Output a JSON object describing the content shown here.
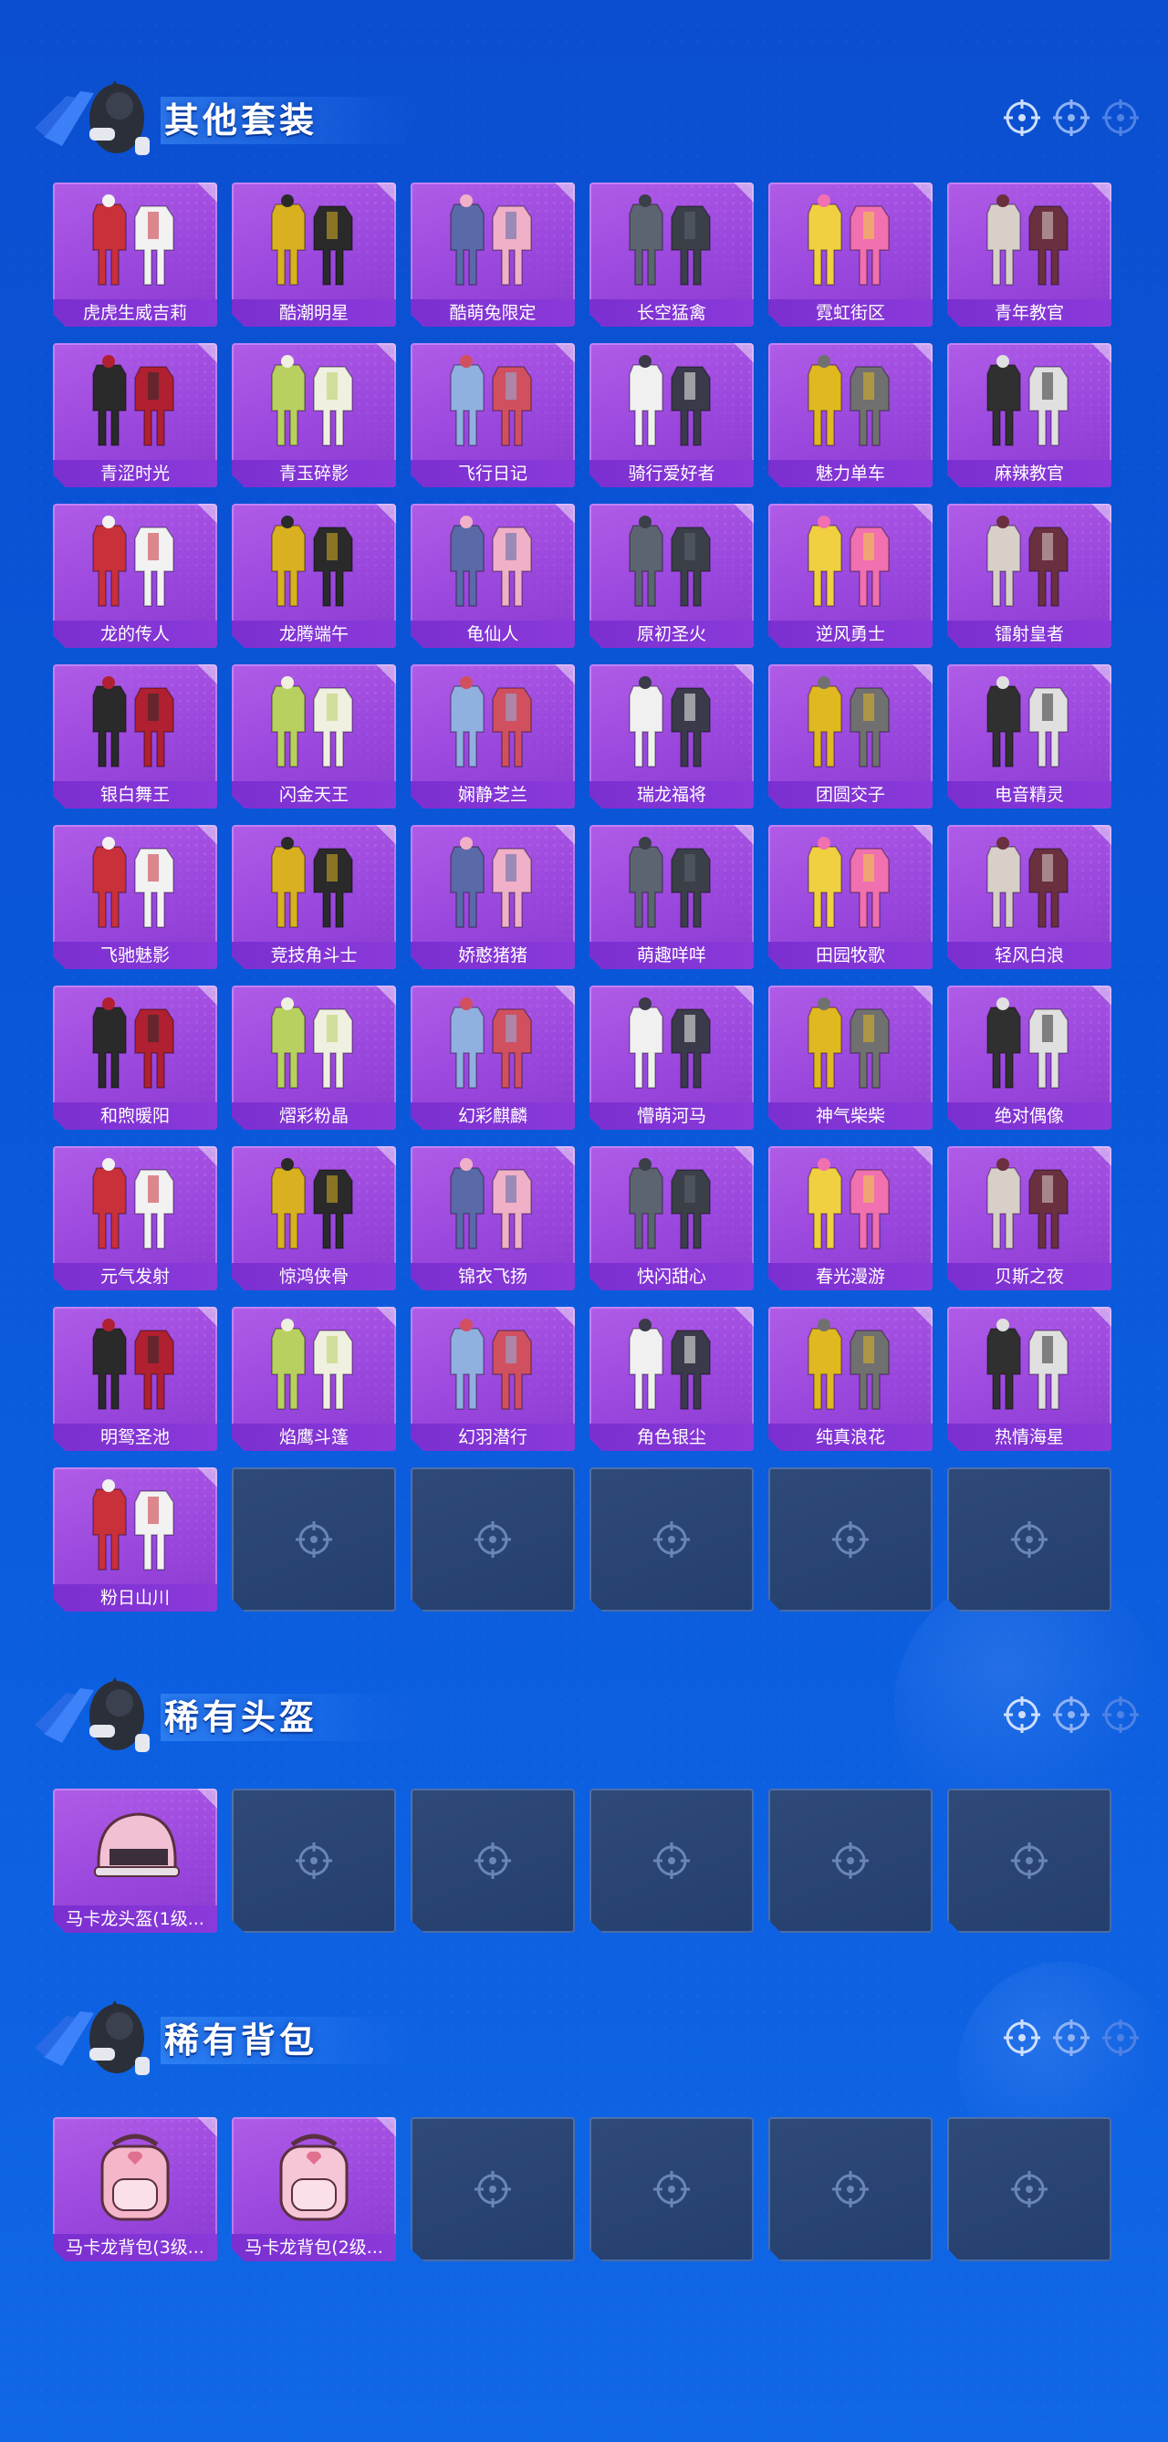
{
  "sections": [
    {
      "title": "其他套装",
      "items": [
        "虎虎生威吉莉",
        "酷潮明星",
        "酷萌兔限定",
        "长空猛禽",
        "霓虹街区",
        "青年教官",
        "青涩时光",
        "青玉碎影",
        "飞行日记",
        "骑行爱好者",
        "魅力单车",
        "麻辣教官",
        "龙的传人",
        "龙腾端午",
        "龟仙人",
        "原初圣火",
        "逆风勇士",
        "镭射皇者",
        "银白舞王",
        "闪金天王",
        "娴静芝兰",
        "瑞龙福将",
        "团圆交子",
        "电音精灵",
        "飞驰魅影",
        "竞技角斗士",
        "娇憨猪猪",
        "萌趣咩咩",
        "田园牧歌",
        "轻风白浪",
        "和煦暖阳",
        "熠彩粉晶",
        "幻彩麒麟",
        "懵萌河马",
        "神气柴柴",
        "绝对偶像",
        "元气发射",
        "惊鸿侠骨",
        "锦衣飞扬",
        "快闪甜心",
        "春光漫游",
        "贝斯之夜",
        "明鸳圣池",
        "焰鹰斗篷",
        "幻羽潜行",
        "角色银尘",
        "纯真浪花",
        "热情海星",
        "粉日山川"
      ],
      "empty_slots": 5
    },
    {
      "title": "稀有头盔",
      "items": [
        "马卡龙头盔(1级..."
      ],
      "empty_slots": 5
    },
    {
      "title": "稀有背包",
      "items": [
        "马卡龙背包(3级...",
        "马卡龙背包(2级..."
      ],
      "empty_slots": 4
    }
  ],
  "colors": {
    "background": "#0b4fd0",
    "card_filled": "#a052e2",
    "card_empty": "#2a446f",
    "label_bar": "#7b2fd0"
  },
  "icons": {
    "empty_slot": "crosshair-icon",
    "header_ornament": "crosshair-icon",
    "header_character": "character-mascot-icon"
  }
}
